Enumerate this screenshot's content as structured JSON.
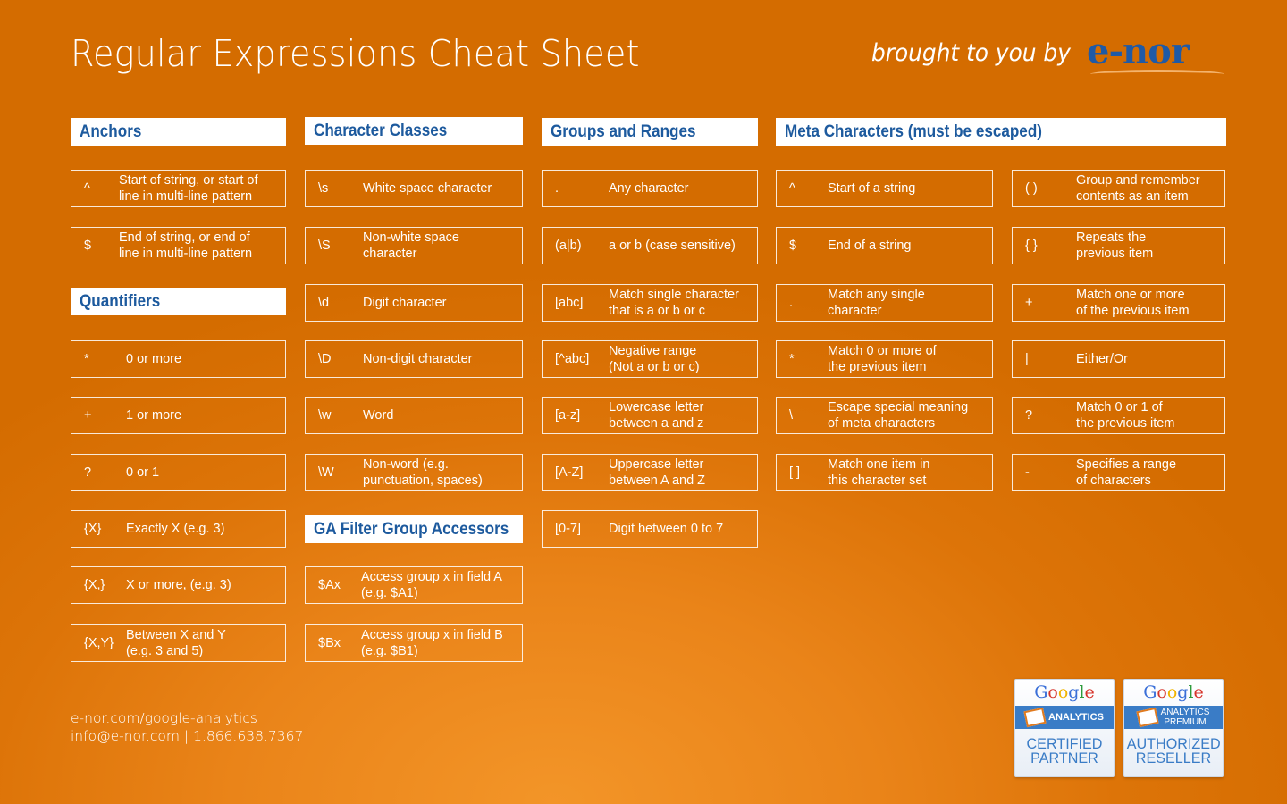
{
  "header": {
    "title": "Regular Expressions Cheat Sheet",
    "brought_by": "brought to you by",
    "logo": "e-nor"
  },
  "sections": {
    "anchors": {
      "title": "Anchors",
      "items": [
        {
          "symbol": "^",
          "desc": "Start of string, or start of\nline in multi-line pattern"
        },
        {
          "symbol": "$",
          "desc": "End of string, or end of\nline in multi-line pattern"
        }
      ]
    },
    "quantifiers": {
      "title": "Quantifiers",
      "items": [
        {
          "symbol": "*",
          "desc": "0 or more"
        },
        {
          "symbol": "+",
          "desc": "1 or more"
        },
        {
          "symbol": "?",
          "desc": "0 or 1"
        },
        {
          "symbol": "{X}",
          "desc": "Exactly X (e.g. 3)"
        },
        {
          "symbol": "{X,}",
          "desc": "X or more, (e.g. 3)"
        },
        {
          "symbol": "{X,Y}",
          "desc": "Between X and Y\n(e.g. 3 and 5)"
        }
      ]
    },
    "character_classes": {
      "title": "Character Classes",
      "items": [
        {
          "symbol": "\\s",
          "desc": "White space character"
        },
        {
          "symbol": "\\S",
          "desc": "Non-white space\ncharacter"
        },
        {
          "symbol": "\\d",
          "desc": "Digit character"
        },
        {
          "symbol": "\\D",
          "desc": "Non-digit character"
        },
        {
          "symbol": "\\w",
          "desc": "Word"
        },
        {
          "symbol": "\\W",
          "desc": "Non-word (e.g.\npunctuation, spaces)"
        }
      ]
    },
    "ga_filter": {
      "title": "GA Filter Group Accessors",
      "items": [
        {
          "symbol": "$Ax",
          "desc": "Access group x in field A\n(e.g. $A1)"
        },
        {
          "symbol": "$Bx",
          "desc": "Access group x in field B\n(e.g. $B1)"
        }
      ]
    },
    "groups_ranges": {
      "title": "Groups and Ranges",
      "items": [
        {
          "symbol": ".",
          "desc": "Any character"
        },
        {
          "symbol": "(a|b)",
          "desc": "a or b (case sensitive)"
        },
        {
          "symbol": "[abc]",
          "desc": "Match single character\nthat is a or b or c"
        },
        {
          "symbol": "[^abc]",
          "desc": "Negative range\n(Not a or b or c)"
        },
        {
          "symbol": "[a-z]",
          "desc": "Lowercase letter\nbetween a and z"
        },
        {
          "symbol": "[A-Z]",
          "desc": "Uppercase letter\nbetween A and Z"
        },
        {
          "symbol": "[0-7]",
          "desc": "Digit between 0 to 7"
        }
      ]
    },
    "meta": {
      "title": "Meta Characters (must be escaped)",
      "left": [
        {
          "symbol": "^",
          "desc": "Start of a string"
        },
        {
          "symbol": "$",
          "desc": "End of a string"
        },
        {
          "symbol": ".",
          "desc": "Match any single\ncharacter"
        },
        {
          "symbol": "*",
          "desc": "Match 0 or more of\nthe previous item"
        },
        {
          "symbol": "\\",
          "desc": "Escape special meaning\nof meta characters"
        },
        {
          "symbol": "[ ]",
          "desc": "Match one item in\nthis character set"
        }
      ],
      "right": [
        {
          "symbol": "( )",
          "desc": "Group and remember\ncontents as an item"
        },
        {
          "symbol": "{ }",
          "desc": "Repeats the\nprevious item"
        },
        {
          "symbol": "+",
          "desc": "Match one or more\nof the previous item"
        },
        {
          "symbol": "|",
          "desc": "Either/Or"
        },
        {
          "symbol": "?",
          "desc": "Match 0 or 1 of\nthe previous item"
        },
        {
          "symbol": "-",
          "desc": "Specifies a range\nof characters"
        }
      ]
    }
  },
  "footer": {
    "website": "e-nor.com/google-analytics",
    "contact": "info@e-nor.com | 1.866.638.7367"
  },
  "badges": [
    {
      "brand": "Google",
      "product": "ANALYTICS",
      "product2": "",
      "line1": "CERTIFIED",
      "line2": "PARTNER"
    },
    {
      "brand": "Google",
      "product": "ANALYTICS",
      "product2": "PREMIUM",
      "line1": "AUTHORIZED",
      "line2": "RESELLER"
    }
  ],
  "colors": {
    "background": "#dd7408",
    "header_text": "#1d5a9e",
    "box_border": "#ffffff"
  }
}
